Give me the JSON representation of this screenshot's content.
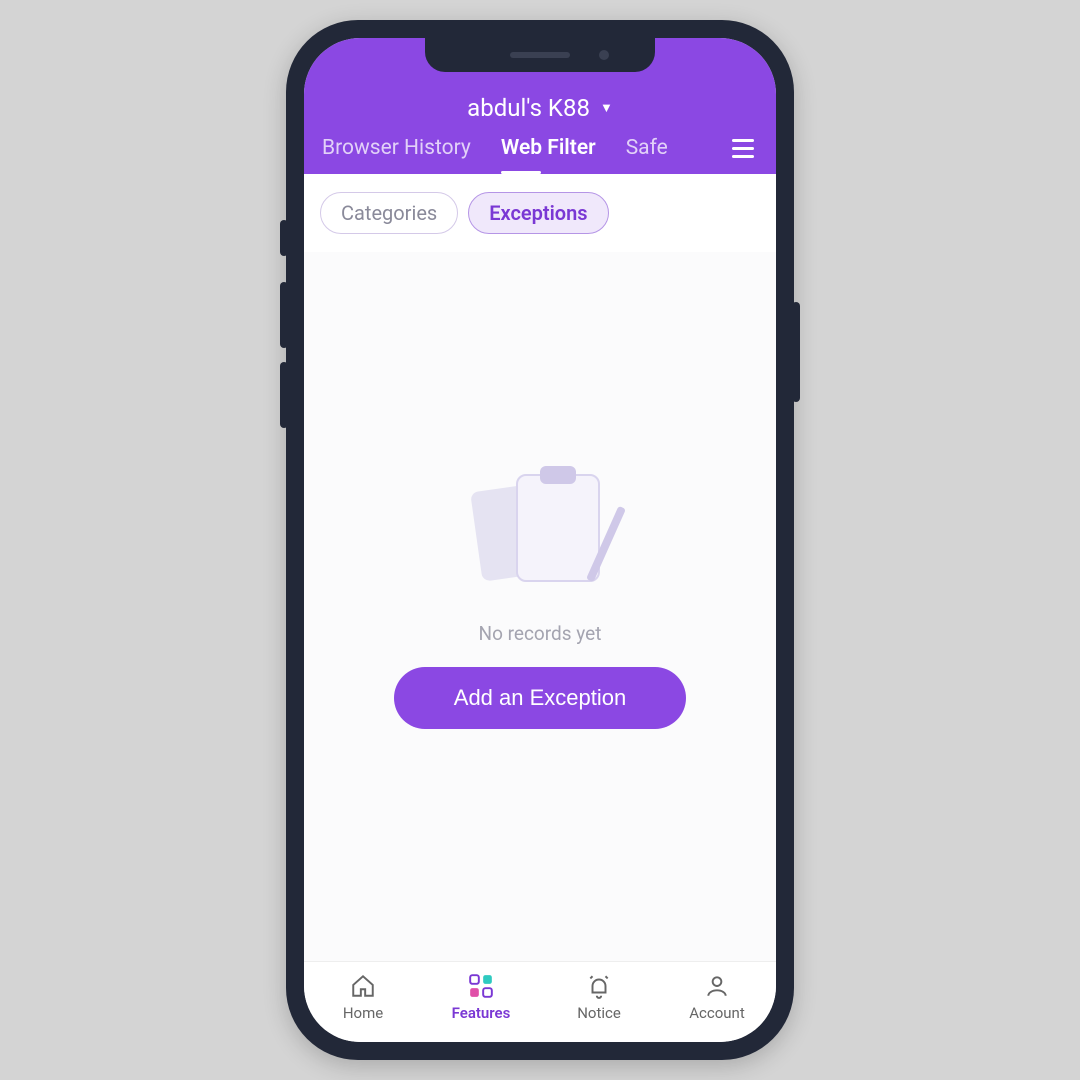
{
  "header": {
    "device_name": "abdul's K88",
    "tabs": [
      "Browser History",
      "Web Filter",
      "Safe"
    ],
    "active_tab_index": 1
  },
  "pills": {
    "items": [
      "Categories",
      "Exceptions"
    ],
    "selected_index": 1
  },
  "empty_state": {
    "message": "No records yet",
    "cta_label": "Add an Exception"
  },
  "bottom_nav": {
    "items": [
      "Home",
      "Features",
      "Notice",
      "Account"
    ],
    "active_index": 1
  },
  "colors": {
    "primary": "#8b48e3"
  }
}
